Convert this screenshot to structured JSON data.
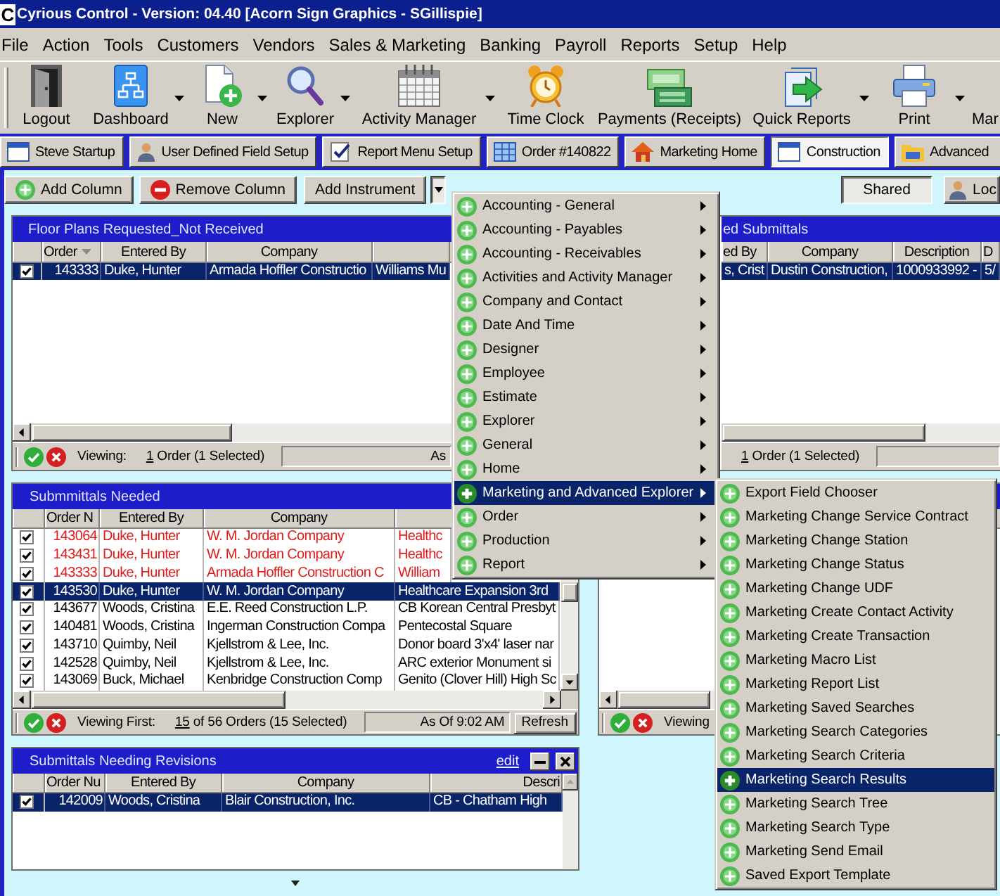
{
  "window": {
    "logo": "C",
    "title": "Cyrious Control - Version: 04.40 [Acorn Sign Graphics - SGillispie]"
  },
  "menu_bar": [
    "File",
    "Action",
    "Tools",
    "Customers",
    "Vendors",
    "Sales & Marketing",
    "Banking",
    "Payroll",
    "Reports",
    "Setup",
    "Help"
  ],
  "toolbar": [
    {
      "label": "Logout",
      "dropdown": false
    },
    {
      "label": "Dashboard",
      "dropdown": true
    },
    {
      "label": "New",
      "dropdown": true
    },
    {
      "label": "Explorer",
      "dropdown": true
    },
    {
      "label": "Activity Manager",
      "dropdown": true
    },
    {
      "label": "Time Clock",
      "dropdown": false
    },
    {
      "label": "Payments (Receipts)",
      "dropdown": false
    },
    {
      "label": "Quick Reports",
      "dropdown": true
    },
    {
      "label": "Print",
      "dropdown": true
    },
    {
      "label": "Mar",
      "dropdown": false
    }
  ],
  "tabs": [
    {
      "label": "Steve Startup",
      "selected": false
    },
    {
      "label": "User Defined Field Setup",
      "selected": false
    },
    {
      "label": "Report Menu Setup",
      "selected": false
    },
    {
      "label": "Order #140822",
      "selected": false
    },
    {
      "label": "Marketing Home",
      "selected": false
    },
    {
      "label": "Construction",
      "selected": true
    },
    {
      "label": "Advanced",
      "selected": false
    }
  ],
  "action_bar": {
    "buttons": [
      {
        "label": "Add Column",
        "kind": "add"
      },
      {
        "label": "Remove Column",
        "kind": "remove"
      },
      {
        "label": "Add Instrument",
        "kind": "plain"
      }
    ],
    "dropdown": {
      "pressed": true
    },
    "right_buttons": [
      {
        "label": "Shared",
        "pressed": true
      },
      {
        "label": "Loc",
        "pressed": false
      }
    ]
  },
  "panels": [
    {
      "title": "Floor Plans Requested_Not Received",
      "columns": [
        {
          "label": "Order",
          "sorted": true
        },
        {
          "label": "Entered By",
          "sorted": false
        },
        {
          "label": "Company",
          "sorted": false
        }
      ],
      "rows": [
        {
          "checked": true,
          "selected": true,
          "cells": [
            "143333",
            "Duke, Hunter",
            "Armada Hoffler Constructio",
            "Williams Mu"
          ]
        }
      ],
      "status": {
        "label": "Viewing:",
        "count": "1",
        "summary": "Order (1 Selected)",
        "as_of": "As"
      }
    },
    {
      "title": "ed Submittals",
      "columns": [
        {
          "label": "ed By"
        },
        {
          "label": "Company"
        },
        {
          "label": "Description"
        },
        {
          "label": "D"
        }
      ],
      "rows": [
        {
          "selected": true,
          "cells": [
            "s, Crist",
            "Dustin Construction,",
            "1000933992 -",
            "5/"
          ]
        }
      ],
      "status": {
        "count": "1",
        "summary": "Order (1 Selected)"
      }
    },
    {
      "title": "Submmittals Needed",
      "columns": [
        {
          "label": "Order N"
        },
        {
          "label": "Entered By"
        },
        {
          "label": "Company"
        }
      ],
      "rows": [
        {
          "checked": true,
          "selected": false,
          "color": "#e01b1b",
          "cells": [
            "143064",
            "Duke, Hunter",
            "W. M. Jordan Company",
            "Healthc"
          ]
        },
        {
          "checked": true,
          "selected": false,
          "color": "#e01b1b",
          "cells": [
            "143431",
            "Duke, Hunter",
            "W. M. Jordan Company",
            "Healthc"
          ]
        },
        {
          "checked": true,
          "selected": false,
          "color": "#e01b1b",
          "cells": [
            "143333",
            "Duke, Hunter",
            "Armada Hoffler Construction C",
            "William"
          ]
        },
        {
          "checked": true,
          "selected": true,
          "cells": [
            "143530",
            "Duke, Hunter",
            "W. M. Jordan Company",
            "Healthcare Expansion 3rd"
          ]
        },
        {
          "checked": true,
          "selected": false,
          "color": "#000000",
          "cells": [
            "143677",
            "Woods, Cristina",
            "E.E. Reed Construction L.P.",
            "CB Korean Central Presbyt"
          ]
        },
        {
          "checked": true,
          "selected": false,
          "color": "#000000",
          "cells": [
            "140481",
            "Woods, Cristina",
            "Ingerman Construction Compa",
            "Pentecostal Square"
          ]
        },
        {
          "checked": true,
          "selected": false,
          "color": "#000000",
          "cells": [
            "143710",
            "Quimby, Neil",
            "Kjellstrom & Lee, Inc.",
            "Donor board 3'x4' laser nar"
          ]
        },
        {
          "checked": true,
          "selected": false,
          "color": "#000000",
          "cells": [
            "142528",
            "Quimby, Neil",
            "Kjellstrom & Lee, Inc.",
            "ARC exterior Monument si"
          ]
        },
        {
          "checked": true,
          "selected": false,
          "color": "#000000",
          "cells": [
            "143069",
            "Buck, Michael",
            "Kenbridge Construction Comp",
            "Genito (Clover Hill) High Sc"
          ]
        }
      ],
      "status": {
        "label": "Viewing First:",
        "count": "15",
        "summary": "of 56 Orders (15 Selected)",
        "as_of": "As Of 9:02 AM",
        "refresh": "Refresh"
      }
    },
    {
      "status": {
        "label": "Viewing"
      }
    },
    {
      "title": "Submittals Needing Revisions",
      "edit_link": "edit",
      "columns": [
        {
          "label": "Order Nu"
        },
        {
          "label": "Entered By"
        },
        {
          "label": "Company"
        },
        {
          "label": "Descri"
        }
      ],
      "rows": [
        {
          "checked": true,
          "selected": true,
          "cells": [
            "142009",
            "Woods, Cristina",
            "Blair Construction, Inc.",
            "CB - Chatham High"
          ]
        }
      ]
    }
  ],
  "instrument_menu": {
    "items": [
      {
        "label": "Accounting - General",
        "selected": false
      },
      {
        "label": "Accounting - Payables",
        "selected": false
      },
      {
        "label": "Accounting - Receivables",
        "selected": false
      },
      {
        "label": "Activities and Activity Manager",
        "selected": false
      },
      {
        "label": "Company and Contact",
        "selected": false
      },
      {
        "label": "Date And Time",
        "selected": false
      },
      {
        "label": "Designer",
        "selected": false
      },
      {
        "label": "Employee",
        "selected": false
      },
      {
        "label": "Estimate",
        "selected": false
      },
      {
        "label": "Explorer",
        "selected": false
      },
      {
        "label": "General",
        "selected": false
      },
      {
        "label": "Home",
        "selected": false
      },
      {
        "label": "Marketing and Advanced Explorer",
        "selected": true,
        "children": [
          {
            "label": "Export Field Chooser",
            "selected": false
          },
          {
            "label": "Marketing Change Service Contract",
            "selected": false
          },
          {
            "label": "Marketing Change Station",
            "selected": false
          },
          {
            "label": "Marketing Change Status",
            "selected": false
          },
          {
            "label": "Marketing Change UDF",
            "selected": false
          },
          {
            "label": "Marketing Create Contact Activity",
            "selected": false
          },
          {
            "label": "Marketing Create Transaction",
            "selected": false
          },
          {
            "label": "Marketing Macro List",
            "selected": false
          },
          {
            "label": "Marketing Report List",
            "selected": false
          },
          {
            "label": "Marketing Saved Searches",
            "selected": false
          },
          {
            "label": "Marketing Search Categories",
            "selected": false
          },
          {
            "label": "Marketing Search Criteria",
            "selected": false
          },
          {
            "label": "Marketing Search Results",
            "selected": true
          },
          {
            "label": "Marketing Search Tree",
            "selected": false
          },
          {
            "label": "Marketing Search Type",
            "selected": false
          },
          {
            "label": "Marketing Send Email",
            "selected": false
          },
          {
            "label": "Saved Export Template",
            "selected": false
          }
        ]
      },
      {
        "label": "Order",
        "selected": false
      },
      {
        "label": "Production",
        "selected": false
      },
      {
        "label": "Report",
        "selected": false
      }
    ]
  }
}
